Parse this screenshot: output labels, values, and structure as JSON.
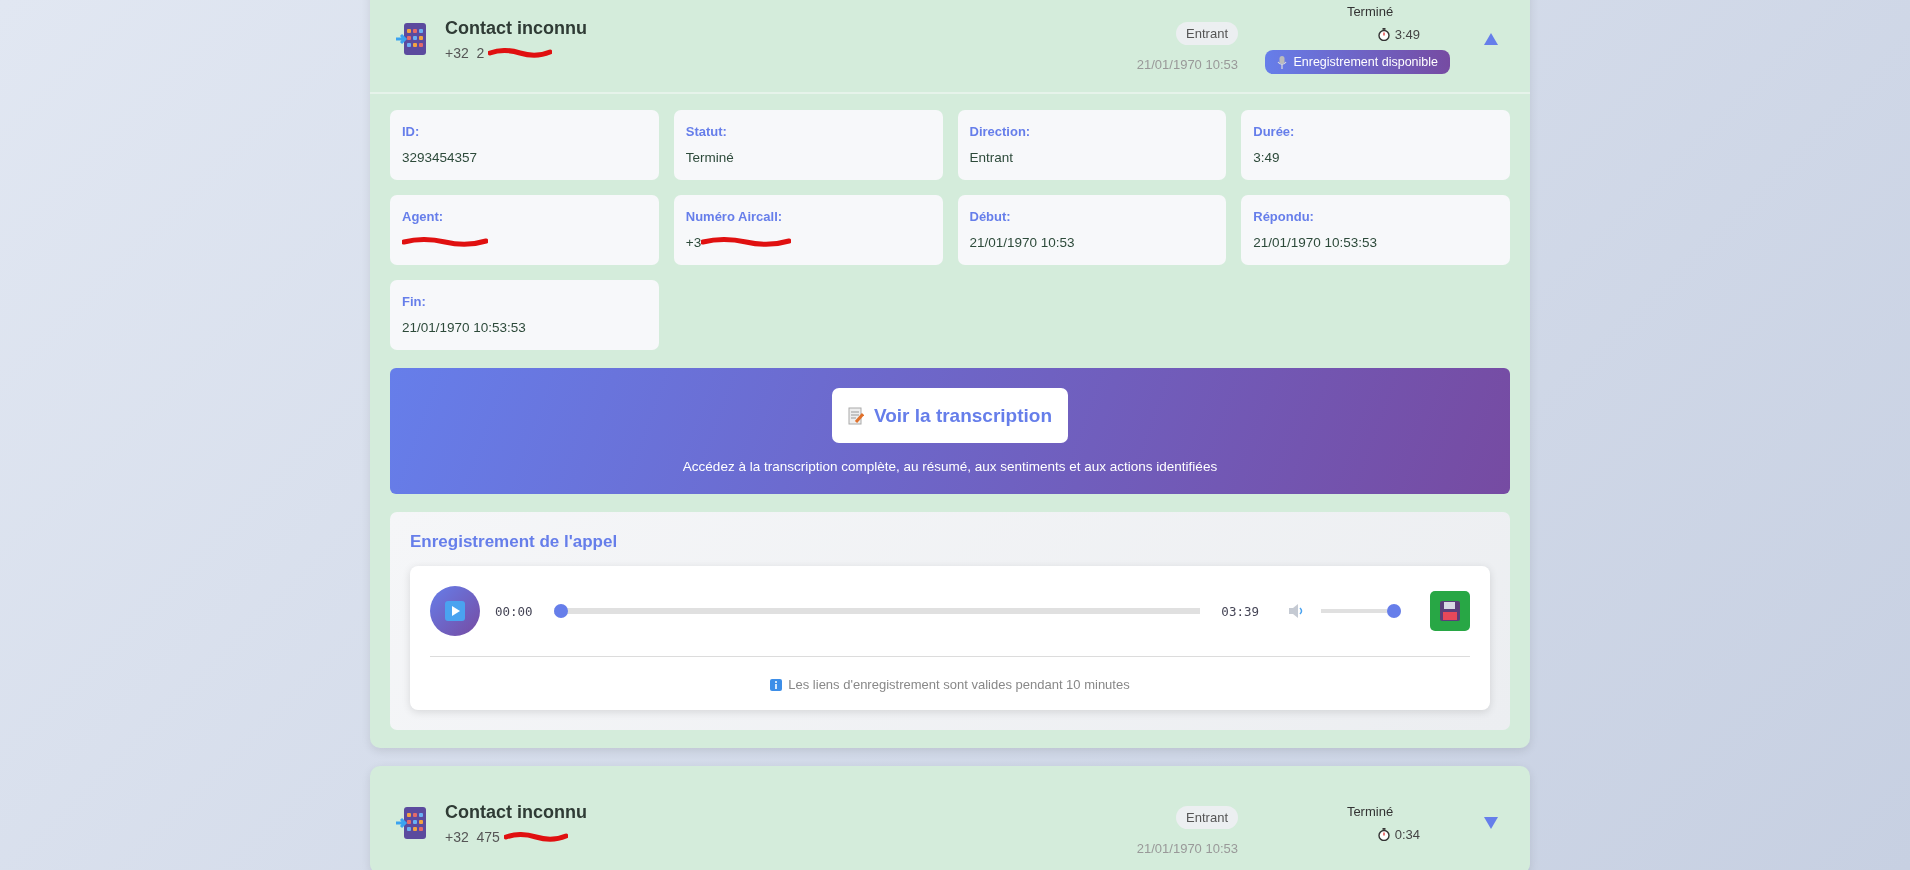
{
  "calls": [
    {
      "contact": "Contact inconnu",
      "phone": {
        "text": "+32  2",
        "redacted": true
      },
      "direction": "Entrant",
      "date": "21/01/1970 10:53",
      "status": "Terminé",
      "duration": "3:49",
      "recording_badge": "Enregistrement disponible",
      "expanded": true,
      "details": [
        {
          "label": "ID:",
          "value": "3293454357"
        },
        {
          "label": "Statut:",
          "value": "Terminé"
        },
        {
          "label": "Direction:",
          "value": "Entrant"
        },
        {
          "label": "Durée:",
          "value": "3:49"
        },
        {
          "label": "Agent:",
          "redacted": true
        },
        {
          "label": "Numéro Aircall:",
          "value": "+3",
          "redacted": true
        },
        {
          "label": "Début:",
          "value": "21/01/1970 10:53"
        },
        {
          "label": "Répondu:",
          "value": "21/01/1970 10:53:53"
        },
        {
          "label": "Fin:",
          "value": "21/01/1970 10:53:53"
        }
      ],
      "transcript": {
        "button": "Voir la transcription",
        "caption": "Accédez à la transcription complète, au résumé, aux sentiments et aux actions identifiées"
      },
      "recording": {
        "title": "Enregistrement de l'appel",
        "current_time": "00:00",
        "progress": {
          "level": 0
        },
        "total_time": "03:39",
        "volume": {
          "level": 1
        },
        "note": "Les liens d'enregistrement sont valides pendant 10 minutes"
      }
    },
    {
      "contact": "Contact inconnu",
      "phone": {
        "text": "+32  475",
        "redacted": true
      },
      "direction": "Entrant",
      "date": "21/01/1970 10:53",
      "status": "Terminé",
      "duration": "0:34",
      "expanded": false
    }
  ]
}
